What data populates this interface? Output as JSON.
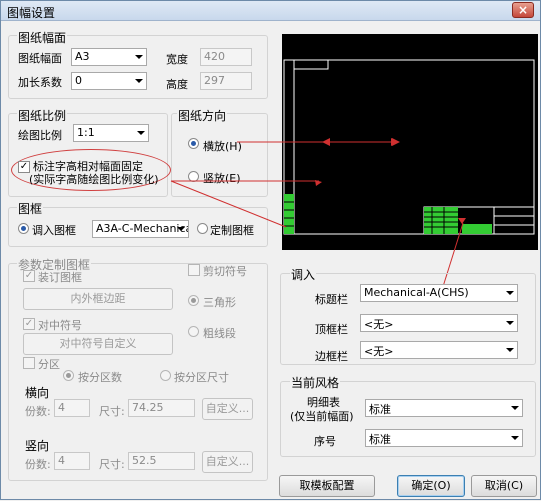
{
  "window": {
    "title": "图幅设置",
    "close_glyph": "×"
  },
  "paper_size": {
    "group_title": "图纸幅面",
    "size_label": "图纸幅面",
    "size_value": "A3",
    "width_label": "宽度",
    "width_value": "420",
    "extend_label": "加长系数",
    "extend_value": "0",
    "height_label": "高度",
    "height_value": "297"
  },
  "scale": {
    "group_title": "图纸比例",
    "label": "绘图比例",
    "value": "1:1",
    "lock_label_1": "标注字高相对幅面固定",
    "lock_label_2": "(实际字高随绘图比例变化)",
    "lock_checked": "✓"
  },
  "orientation": {
    "group_title": "图纸方向",
    "landscape": "横放(H)",
    "portrait": "竖放(E)"
  },
  "frame": {
    "group_title": "图框",
    "load_label": "调入图框",
    "load_value": "A3A-C-Mechanica",
    "custom_label": "定制图框"
  },
  "param_frame": {
    "group_title": "参数定制图框",
    "binding_label": "装订图框",
    "inner_margin_btn": "内外框边距",
    "center_mark_label": "对中符号",
    "center_custom_btn": "对中符号自定义",
    "cut_mark_label": "剪切符号",
    "triangle_label": "三角形",
    "thick_label": "粗线段",
    "zone_label": "分区",
    "by_count": "按分区数",
    "by_size": "按分区尺寸",
    "horizontal_title": "横向",
    "h_count_label": "份数:",
    "h_count_value": "4",
    "h_size_label": "尺寸:",
    "h_size_value": "74.25",
    "h_custom_btn": "自定义...",
    "vertical_title": "竖向",
    "v_count_label": "份数:",
    "v_count_value": "4",
    "v_size_label": "尺寸:",
    "v_size_value": "52.5",
    "v_custom_btn": "自定义..."
  },
  "load_in": {
    "group_title": "调入",
    "title_block_label": "标题栏",
    "title_block_value": "Mechanical-A(CHS)",
    "top_bar_label": "顶框栏",
    "top_bar_value": "<无>",
    "side_bar_label": "边框栏",
    "side_bar_value": "<无>"
  },
  "style": {
    "group_title": "当前风格",
    "bom_label_1": "明细表",
    "bom_label_2": "(仅当前幅面)",
    "bom_value": "标准",
    "seq_label": "序号",
    "seq_value": "标准"
  },
  "buttons": {
    "template_config": "取模板配置",
    "ok": "确定(O)",
    "cancel": "取消(C)"
  },
  "colors": {
    "annotation_red": "#d03030",
    "preview_bg": "#000000",
    "preview_green": "#33cc33"
  }
}
